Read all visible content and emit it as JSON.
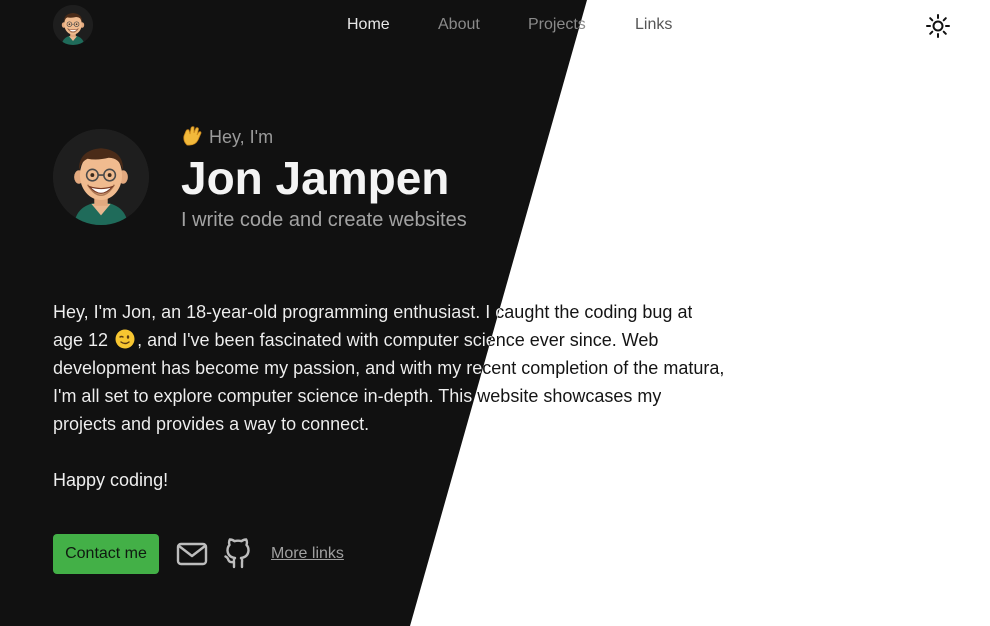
{
  "nav": {
    "avatar_icon": "memoji-avatar-icon",
    "links": [
      {
        "label": "Home",
        "active": true
      },
      {
        "label": "About",
        "active": false
      },
      {
        "label": "Projects",
        "active": false
      },
      {
        "label": "Links",
        "active": false
      }
    ],
    "theme_toggle_icon": "sun-icon"
  },
  "hero": {
    "avatar_icon": "memoji-avatar-icon",
    "wave_icon": "waving-hand-icon",
    "greeting": "Hey, I'm",
    "name": "Jon Jampen",
    "tagline": "I write code and create websites"
  },
  "bio": {
    "paragraph_1_part_1": "Hey, I'm Jon, an 18-year-old programming enthusiast. I caught the coding bug at age 12",
    "wink_icon": "winking-face-icon",
    "paragraph_1_part_2": ", and I've been fascinated with computer science ever since. Web development has become my passion, and with my recent completion of the matura, I'm all set to explore computer science in-depth. This website showcases my projects and provides a way to connect.",
    "paragraph_2": "Happy coding!"
  },
  "actions": {
    "contact_label": "Contact me",
    "mail_icon": "mail-icon",
    "github_icon": "github-icon",
    "more_links_label": "More links"
  },
  "colors": {
    "dark_background": "#111111",
    "light_background": "#ffffff",
    "accent_green": "#43b047"
  }
}
